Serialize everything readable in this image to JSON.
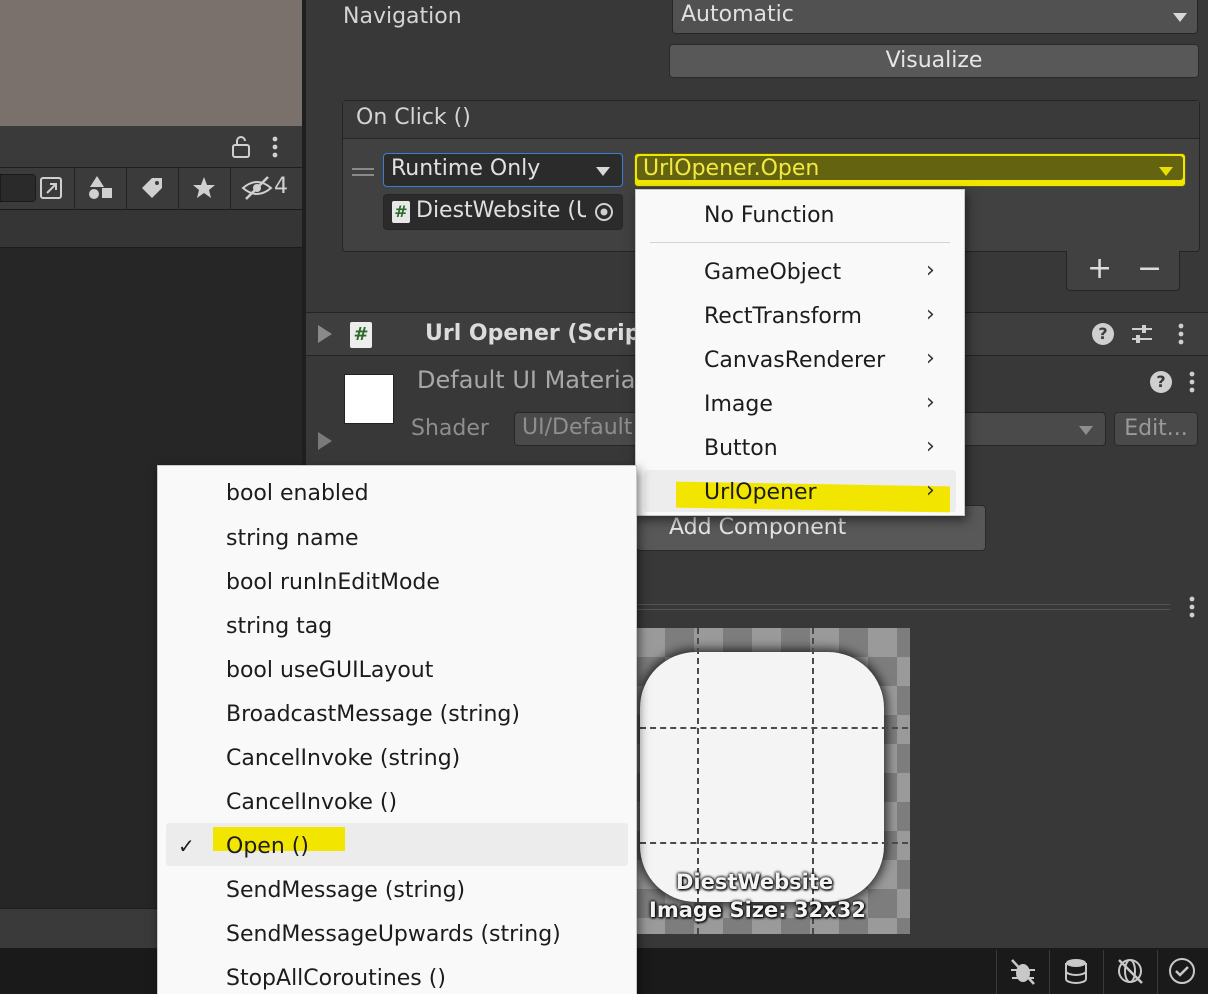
{
  "left_panel": {
    "toolbar_count": "4"
  },
  "inspector": {
    "navigation_label": "Navigation",
    "navigation_value": "Automatic",
    "visualize_button": "Visualize",
    "on_click": {
      "header": "On Click ()",
      "runtime_value": "Runtime Only",
      "function_value": "UrlOpener.Open",
      "target_object": "DiestWebsite (U",
      "add_button": "+",
      "remove_button": "−"
    },
    "component": {
      "title": "Url Opener (Script",
      "icon_glyph": "#"
    },
    "material": {
      "name": "Default UI Materia",
      "shader_label": "Shader",
      "shader_value": "UI/Default",
      "edit_button": "Edit..."
    },
    "add_component_button": "Add Component"
  },
  "function_menu": {
    "no_function": "No Function",
    "items": [
      {
        "label": "GameObject"
      },
      {
        "label": "RectTransform"
      },
      {
        "label": "CanvasRenderer"
      },
      {
        "label": "Image"
      },
      {
        "label": "Button"
      },
      {
        "label": "UrlOpener"
      }
    ]
  },
  "method_menu": {
    "items": [
      {
        "label": "bool enabled"
      },
      {
        "label": "string name"
      },
      {
        "label": "bool runInEditMode"
      },
      {
        "label": "string tag"
      },
      {
        "label": "bool useGUILayout"
      },
      {
        "label": "BroadcastMessage (string)"
      },
      {
        "label": "CancelInvoke (string)"
      },
      {
        "label": "CancelInvoke ()"
      },
      {
        "label": "Open ()"
      },
      {
        "label": "SendMessage (string)"
      },
      {
        "label": "SendMessageUpwards (string)"
      },
      {
        "label": "StopAllCoroutines ()"
      }
    ],
    "checked_item": "Open ()",
    "check_glyph": "✓"
  },
  "preview": {
    "name": "DiestWebsite",
    "size": "Image Size: 32x32"
  },
  "colors": {
    "highlight": "#f2e600",
    "panel": "#383838",
    "menu": "#f9f9f9"
  }
}
